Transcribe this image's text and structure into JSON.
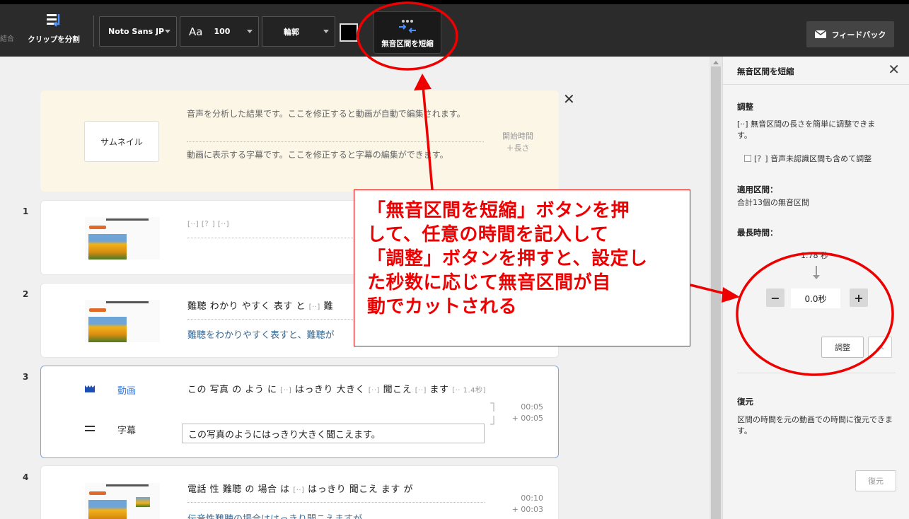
{
  "toolbar": {
    "cut_label": "結合",
    "split_label": "クリップを分割",
    "font_value": "Noto Sans JP",
    "size_icon": "Aa",
    "size_value": "100",
    "outline_value": "輪郭",
    "silence_label": "無音区間を短縮",
    "feedback_label": "フィードバック"
  },
  "info": {
    "thumbnail_label": "サムネイル",
    "speech_desc": "音声を分析した結果です。ここを修正すると動画が自動で編集されます。",
    "sub_desc": "動画に表示する字幕です。ここを修正すると字幕の編集ができます。",
    "time_label_1": "開始時間",
    "time_label_2": "＋長さ"
  },
  "rows": [
    {
      "num": "1",
      "speech": "[··]  [？]  [··]"
    },
    {
      "num": "2",
      "speech_a": "難聴 わかり やすく 表す と",
      "speech_b": "[··]",
      "speech_c": "難",
      "sub": "難聴をわかりやすく表すと、難聴が"
    },
    {
      "num": "3",
      "label_video": "動画",
      "label_sub": "字幕",
      "speech_a": "この 写真 の よう に",
      "speech_b": "[··]",
      "speech_c": "はっきり 大きく",
      "speech_d": "[··]",
      "speech_e": "聞こえ",
      "speech_f": "[··]",
      "speech_g": "ます",
      "speech_h": "[·· 1.4秒]",
      "sub": "この写真のようにはっきり大きく聞こえます。",
      "t1": "00:05",
      "t2": "+ 00:05"
    },
    {
      "num": "4",
      "speech_a": "電話 性 難聴 の 場合 は",
      "speech_b": "[··]",
      "speech_c": "はっきり 聞こえ ます が",
      "sub": "伝音性難聴の場合ははっきり聞こえますが",
      "t1": "00:10",
      "t2": "+ 00:03"
    }
  ],
  "panel": {
    "title": "無音区間を短縮",
    "adjust_heading": "調整",
    "adjust_desc": "[··] 無音区間の長さを簡単に調整できます。",
    "checkbox_label": "[？] 音声未認識区間も含めて調整",
    "range_heading": "適用区間：",
    "range_value": "合計13個の無音区間",
    "max_heading": "最長時間：",
    "max_value": "1.78 秒",
    "stepper_minus": "−",
    "stepper_value": "0.0秒",
    "stepper_plus": "+",
    "adjust_button": "調整",
    "restore_heading": "復元",
    "restore_desc": "区間の時間を元の動画での時間に復元できます。",
    "restore_button": "復元"
  },
  "annotation": {
    "line1": "「無音区間を短縮」ボタンを押",
    "line2": "して、任意の時間を記入して",
    "line3": "「調整」ボタンを押すと、設定し",
    "line4": "た秒数に応じて無音区間が自",
    "line5": "動でカットされる"
  },
  "colors": {
    "annotation": "#e00000",
    "accent_blue": "#3a7be0",
    "toolbar_bg": "#2b2b2b"
  }
}
